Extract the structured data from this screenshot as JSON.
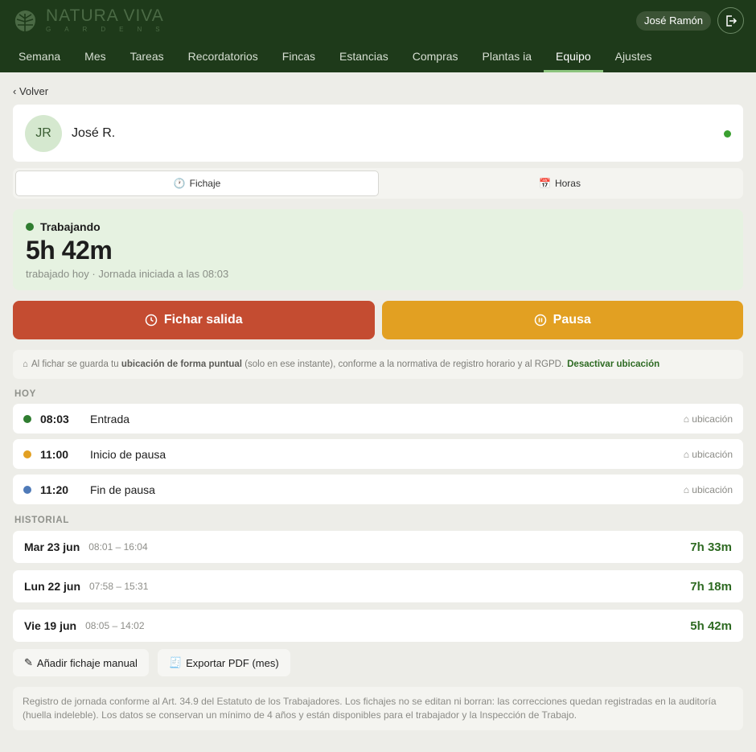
{
  "brand": {
    "name": "NATURA VIVA",
    "subtitle": "GARDENS"
  },
  "header": {
    "user": "José Ramón"
  },
  "nav": [
    {
      "label": "Semana",
      "active": false
    },
    {
      "label": "Mes",
      "active": false
    },
    {
      "label": "Tareas",
      "active": false
    },
    {
      "label": "Recordatorios",
      "active": false
    },
    {
      "label": "Fincas",
      "active": false
    },
    {
      "label": "Estancias",
      "active": false
    },
    {
      "label": "Compras",
      "active": false
    },
    {
      "label": "Plantas ia",
      "active": false
    },
    {
      "label": "Equipo",
      "active": true
    },
    {
      "label": "Ajustes",
      "active": false
    }
  ],
  "back_label": "‹ Volver",
  "profile": {
    "initials": "JR",
    "name": "José R."
  },
  "tabs": {
    "fichaje": "Fichaje",
    "horas": "Horas"
  },
  "status": {
    "label": "Trabajando",
    "time": "5h 42m",
    "subtitle": "trabajado hoy · Jornada iniciada a las 08:03"
  },
  "actions": {
    "out": "Fichar salida",
    "pause": "Pausa"
  },
  "notice": {
    "pre": "Al fichar se guarda tu",
    "bold": "ubicación de forma puntual",
    "post": "(solo en ese instante), conforme a la normativa de registro horario y al RGPD.",
    "link": "Desactivar ubicación"
  },
  "today_title": "HOY",
  "today": [
    {
      "time": "08:03",
      "type": "Entrada",
      "color": "#2f7d30",
      "loc": "ubicación"
    },
    {
      "time": "11:00",
      "type": "Inicio de pausa",
      "color": "#e2a022",
      "loc": "ubicación"
    },
    {
      "time": "11:20",
      "type": "Fin de pausa",
      "color": "#4f7ab8",
      "loc": "ubicación"
    }
  ],
  "history_title": "HISTORIAL",
  "history": [
    {
      "date": "Mar 23 jun",
      "range": "08:01 – 16:04",
      "total": "7h 33m"
    },
    {
      "date": "Lun 22 jun",
      "range": "07:58 – 15:31",
      "total": "7h 18m"
    },
    {
      "date": "Vie 19 jun",
      "range": "08:05 – 14:02",
      "total": "5h 42m"
    }
  ],
  "buttons": {
    "manual": "Añadir fichaje manual",
    "export": "Exportar PDF (mes)"
  },
  "legal": "Registro de jornada conforme al Art. 34.9 del Estatuto de los Trabajadores. Los fichajes no se editan ni borran: las correcciones quedan registradas en la auditoría (huella indeleble). Los datos se conservan un mínimo de 4 años y están disponibles para el trabajador y la Inspección de Trabajo."
}
